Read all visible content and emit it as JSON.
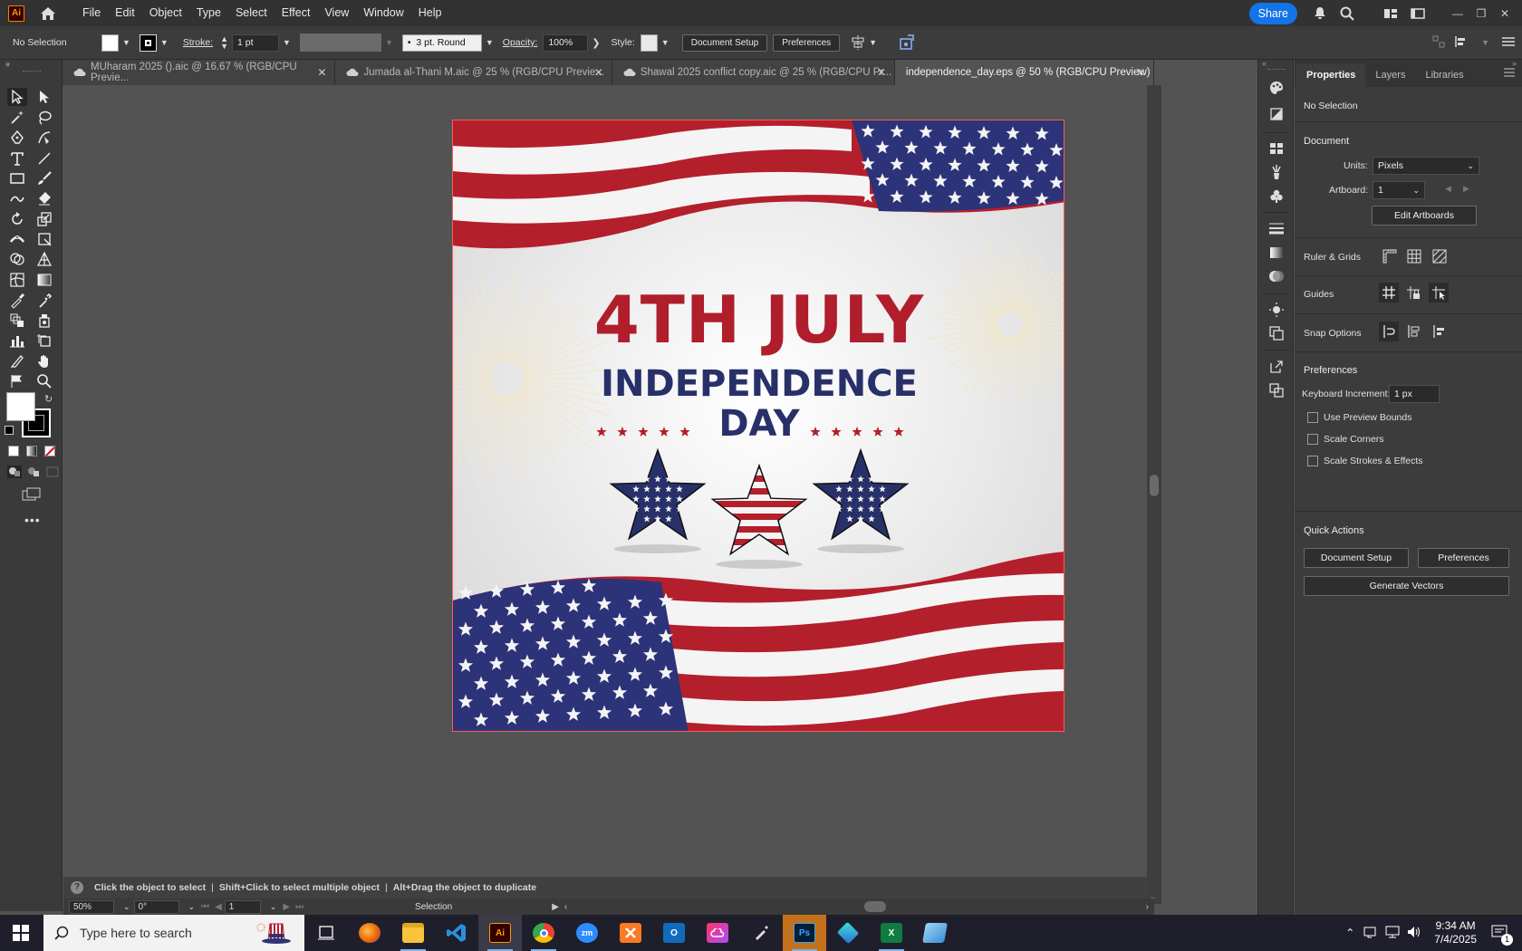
{
  "app": {
    "logo": "Ai"
  },
  "menu": [
    "File",
    "Edit",
    "Object",
    "Type",
    "Select",
    "Effect",
    "View",
    "Window",
    "Help"
  ],
  "topright": {
    "share": "Share"
  },
  "control": {
    "selection": "No Selection",
    "stroke_label": "Stroke:",
    "stroke_value": "1 pt",
    "brush": "3 pt. Round",
    "opacity_label": "Opacity:",
    "opacity_value": "100%",
    "style_label": "Style:",
    "doc_setup": "Document Setup",
    "preferences": "Preferences"
  },
  "tabs": [
    {
      "label": "MUharam 2025 ().aic @ 16.67 % (RGB/CPU Previe...",
      "cloud": true,
      "active": false
    },
    {
      "label": "Jumada al-Thani M.aic @ 25 % (RGB/CPU Previe...",
      "cloud": true,
      "active": false
    },
    {
      "label": "Shawal 2025 conflict copy.aic @ 25 % (RGB/CPU Pr...",
      "cloud": true,
      "active": false
    },
    {
      "label": "independence_day.eps @ 50 % (RGB/CPU Preview)",
      "cloud": false,
      "active": true
    }
  ],
  "artwork": {
    "line1": "4TH JULY",
    "line2": "INDEPENDENCE",
    "line3": "DAY",
    "colors": {
      "red": "#b01e2b",
      "navy": "#283069",
      "flag_blue": "#2c3378"
    }
  },
  "hint": {
    "a": "Click the object to select",
    "b": "Shift+Click to select multiple object",
    "c": "Alt+Drag the object to duplicate"
  },
  "status": {
    "zoom": "50%",
    "rotate": "0°",
    "artboard": "1",
    "tool": "Selection"
  },
  "props": {
    "tabs": [
      "Properties",
      "Layers",
      "Libraries"
    ],
    "selection": "No Selection",
    "document": "Document",
    "units_label": "Units:",
    "units_value": "Pixels",
    "artboard_label": "Artboard:",
    "artboard_value": "1",
    "edit_artboards": "Edit Artboards",
    "ruler_grids": "Ruler & Grids",
    "guides": "Guides",
    "snap": "Snap Options",
    "preferences": "Preferences",
    "key_inc_label": "Keyboard Increment:",
    "key_inc_value": "1 px",
    "chk1": "Use Preview Bounds",
    "chk2": "Scale Corners",
    "chk3": "Scale Strokes & Effects",
    "quick": "Quick Actions",
    "qa_doc_setup": "Document Setup",
    "qa_prefs": "Preferences",
    "qa_generate": "Generate Vectors"
  },
  "taskbar": {
    "search": "Type here to search",
    "time": "9:34 AM",
    "date": "7/4/2025",
    "notif": "1",
    "apps": [
      "task-view",
      "firefox",
      "file-explorer",
      "vscode",
      "illustrator",
      "chrome",
      "zoom",
      "xampp",
      "outlook",
      "creative-cloud",
      "pen-tool",
      "photoshop",
      "app-cube",
      "excel",
      "notepad"
    ]
  }
}
